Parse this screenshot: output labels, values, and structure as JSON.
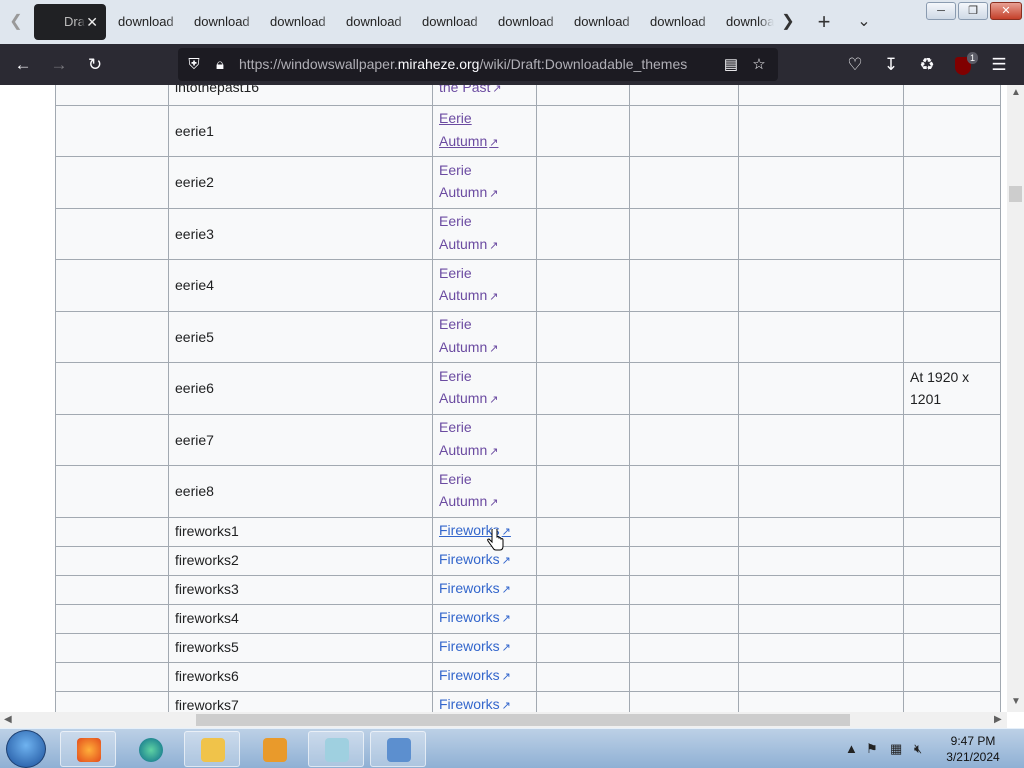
{
  "tabs": {
    "active": {
      "label": "Dra"
    },
    "background": [
      "download",
      "download",
      "download",
      "download",
      "download",
      "download",
      "download",
      "download",
      "downloa"
    ]
  },
  "address_bar": {
    "url_prefix": "https://windowswallpaper.",
    "url_domain": "miraheze.org",
    "url_path": "/wiki/Draft:Downloadable_themes"
  },
  "toolbar": {
    "extension_badge": "1"
  },
  "table": {
    "partial_top_row": {
      "name": "intothepast16",
      "link": "the Past"
    },
    "rows": [
      {
        "name": "eerie1",
        "link_line1": "Eerie",
        "link_line2": "Autumn",
        "note": ""
      },
      {
        "name": "eerie2",
        "link_line1": "Eerie",
        "link_line2": "Autumn",
        "note": ""
      },
      {
        "name": "eerie3",
        "link_line1": "Eerie",
        "link_line2": "Autumn",
        "note": ""
      },
      {
        "name": "eerie4",
        "link_line1": "Eerie",
        "link_line2": "Autumn",
        "note": ""
      },
      {
        "name": "eerie5",
        "link_line1": "Eerie",
        "link_line2": "Autumn",
        "note": ""
      },
      {
        "name": "eerie6",
        "link_line1": "Eerie",
        "link_line2": "Autumn",
        "note_line1": "At 1920 x",
        "note_line2": "1201"
      },
      {
        "name": "eerie7",
        "link_line1": "Eerie",
        "link_line2": "Autumn",
        "note": ""
      },
      {
        "name": "eerie8",
        "link_line1": "Eerie",
        "link_line2": "Autumn",
        "note": ""
      }
    ],
    "short_rows": [
      {
        "name": "fireworks1",
        "link": "Fireworks"
      },
      {
        "name": "fireworks2",
        "link": "Fireworks"
      },
      {
        "name": "fireworks3",
        "link": "Fireworks"
      },
      {
        "name": "fireworks4",
        "link": "Fireworks"
      },
      {
        "name": "fireworks5",
        "link": "Fireworks"
      },
      {
        "name": "fireworks6",
        "link": "Fireworks"
      },
      {
        "name": "fireworks7",
        "link": "Fireworks"
      }
    ]
  },
  "taskbar": {
    "time": "9:47 PM",
    "date": "3/21/2024"
  },
  "colors": {
    "link": "#3366cc",
    "visited_link": "#6b4ba1",
    "nav_bg": "#2b2a33"
  }
}
